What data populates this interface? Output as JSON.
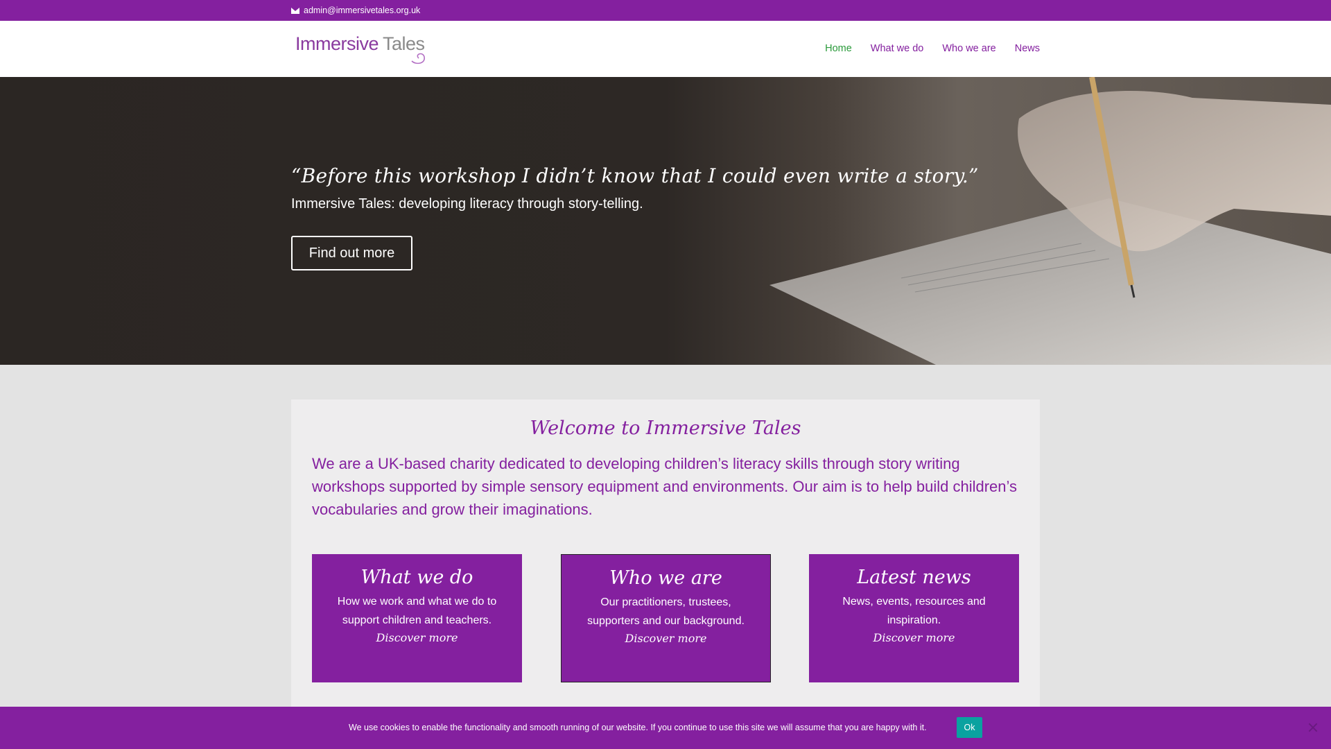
{
  "topbar": {
    "email": "admin@immersivetales.org.uk",
    "email_icon": "envelope-icon"
  },
  "header": {
    "logo": {
      "word1": "Immersive",
      "word2": "Tales"
    },
    "nav": [
      {
        "label": "Home",
        "active": true
      },
      {
        "label": "What we do",
        "active": false
      },
      {
        "label": "Who we are",
        "active": false
      },
      {
        "label": "News",
        "active": false
      }
    ]
  },
  "hero": {
    "quote": "“Before this workshop I didn’t know that I could even write a story.”",
    "subtitle": "Immersive Tales: developing literacy through story-telling.",
    "button": "Find out more"
  },
  "main": {
    "welcome": "Welcome to Immersive Tales",
    "intro": "We are a UK-based charity dedicated to developing children’s literacy skills through story writing workshops supported by simple sensory equipment and environments. Our aim is to help build children’s vocabularies and grow their imaginations.",
    "boxes": [
      {
        "title": "What we do",
        "text": "How we work and what we do to support children and teachers.",
        "link": "Discover more"
      },
      {
        "title": "Who we are",
        "text": "Our practitioners, trustees, supporters and our background.",
        "link": "Discover more"
      },
      {
        "title": "Latest news",
        "text": "News, events, resources and inspiration.",
        "link": "Discover more"
      }
    ]
  },
  "cookie": {
    "message": "We use cookies to enable the functionality and smooth running of our website. If you continue to use this site we will assume that you are happy with it.",
    "ok_label": "Ok",
    "close_icon": "close-icon"
  },
  "colors": {
    "brand_purple": "#84209f",
    "nav_active": "#2a9a3a",
    "ok_teal": "#0aa2a0"
  }
}
